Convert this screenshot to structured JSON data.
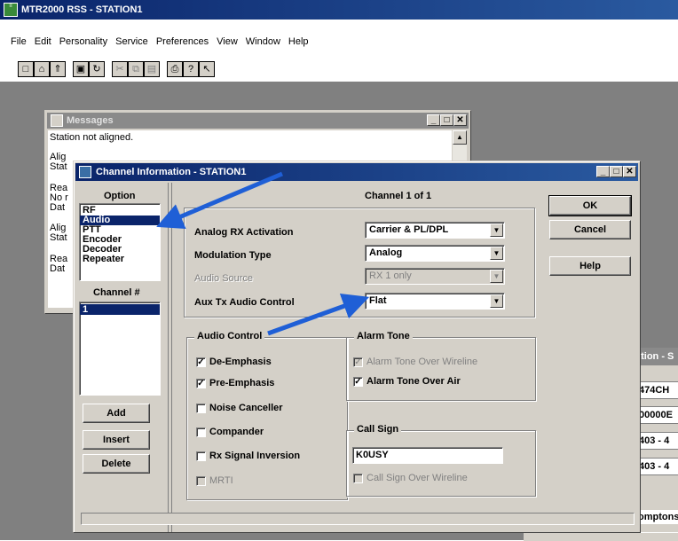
{
  "app": {
    "title": "MTR2000 RSS - STATION1"
  },
  "menu": [
    "File",
    "Edit",
    "Personality",
    "Service",
    "Preferences",
    "View",
    "Window",
    "Help"
  ],
  "messages": {
    "title": "Messages",
    "lines": [
      "Station not aligned.",
      "Alig",
      "Stat",
      "Rea",
      "No r",
      "Dat",
      "Alig",
      "Stat",
      "Rea",
      "Dat"
    ]
  },
  "dialog": {
    "title": "Channel Information - STATION1",
    "option_header": "Option",
    "options": [
      "RF",
      "Audio",
      "PTT",
      "Encoder",
      "Decoder",
      "Repeater"
    ],
    "channel_header": "Channel #",
    "channels": [
      "1"
    ],
    "left_buttons": {
      "add": "Add",
      "insert": "Insert",
      "delete": "Delete"
    },
    "channel_label": "Channel 1 of 1",
    "ok": "OK",
    "cancel": "Cancel",
    "help": "Help",
    "fields": {
      "analog_rx": {
        "label": "Analog RX Activation",
        "value": "Carrier & PL/DPL"
      },
      "modulation": {
        "label": "Modulation Type",
        "value": "Analog"
      },
      "audio_source": {
        "label": "Audio Source",
        "value": "RX 1 only"
      },
      "aux_tx": {
        "label": "Aux Tx Audio Control",
        "value": "Flat"
      }
    },
    "audio_control": {
      "title": "Audio Control",
      "items": [
        {
          "label": "De-Emphasis",
          "checked": "✓"
        },
        {
          "label": "Pre-Emphasis",
          "checked": "✓"
        },
        {
          "label": "Noise Canceller",
          "checked": ""
        },
        {
          "label": "Compander",
          "checked": ""
        },
        {
          "label": "Rx Signal Inversion",
          "checked": ""
        },
        {
          "label": "MRTI",
          "checked": ""
        }
      ]
    },
    "alarm_tone": {
      "title": "Alarm Tone",
      "wireline": {
        "label": "Alarm Tone Over Wireline",
        "checked": "✓"
      },
      "air": {
        "label": "Alarm Tone Over Air",
        "checked": "✓"
      }
    },
    "call_sign": {
      "title": "Call Sign",
      "value": "K0USY",
      "wireline": {
        "label": "Call Sign Over Wireline",
        "checked": ""
      }
    }
  },
  "background_window": {
    "title_fragment": "ation - S",
    "cells": [
      "474CH",
      "00000E",
      "403 - 4",
      "403 - 4",
      "omptons"
    ]
  },
  "colors": {
    "titlebar": "#0a246a",
    "selection": "#0a246a",
    "window_face": "#d4d0c8",
    "workspace": "#808080",
    "arrow": "#1f5fd6"
  }
}
